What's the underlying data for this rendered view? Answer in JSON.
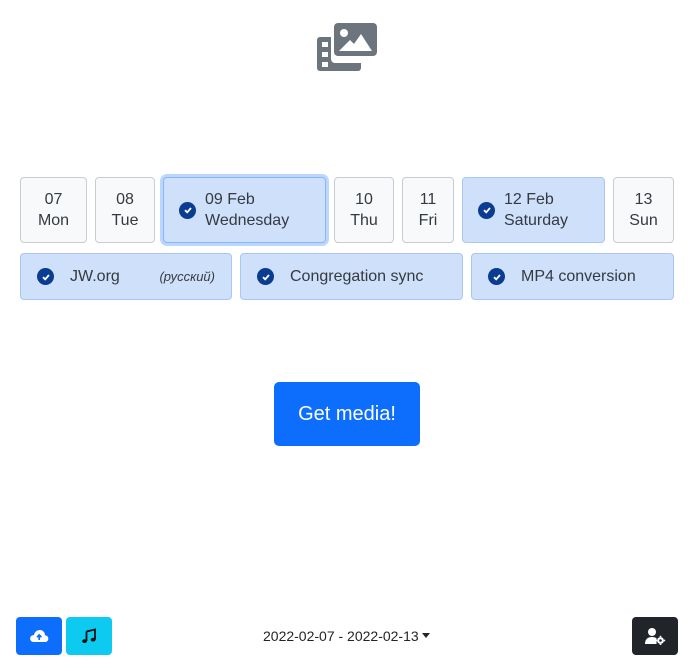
{
  "days": [
    {
      "num": "07",
      "name": "Mon",
      "selected": false
    },
    {
      "num": "08",
      "name": "Tue",
      "selected": false
    },
    {
      "num": "09 Feb",
      "name": "Wednesday",
      "selected": true
    },
    {
      "num": "10",
      "name": "Thu",
      "selected": false
    },
    {
      "num": "11",
      "name": "Fri",
      "selected": false
    },
    {
      "num": "12 Feb",
      "name": "Saturday",
      "selected": true
    },
    {
      "num": "13",
      "name": "Sun",
      "selected": false
    }
  ],
  "options": {
    "jw": {
      "label": "JW.org",
      "language": "(русский)",
      "checked": true
    },
    "sync": {
      "label": "Congregation sync",
      "checked": true
    },
    "mp4": {
      "label": "MP4 conversion",
      "checked": true
    }
  },
  "main": {
    "get_media_label": "Get media!"
  },
  "footer": {
    "date_range": "2022-02-07 - 2022-02-13",
    "upload_icon": "cloud-upload-icon",
    "music_icon": "music-note-icon",
    "settings_icon": "user-cog-icon"
  },
  "colors": {
    "primary": "#0d6efd",
    "selected_bg": "#cfe0fa",
    "check": "#0a3d91",
    "info": "#0dcaf0",
    "dark": "#212529",
    "logo": "#6c757d"
  },
  "logo_icon": "photo-film-icon"
}
